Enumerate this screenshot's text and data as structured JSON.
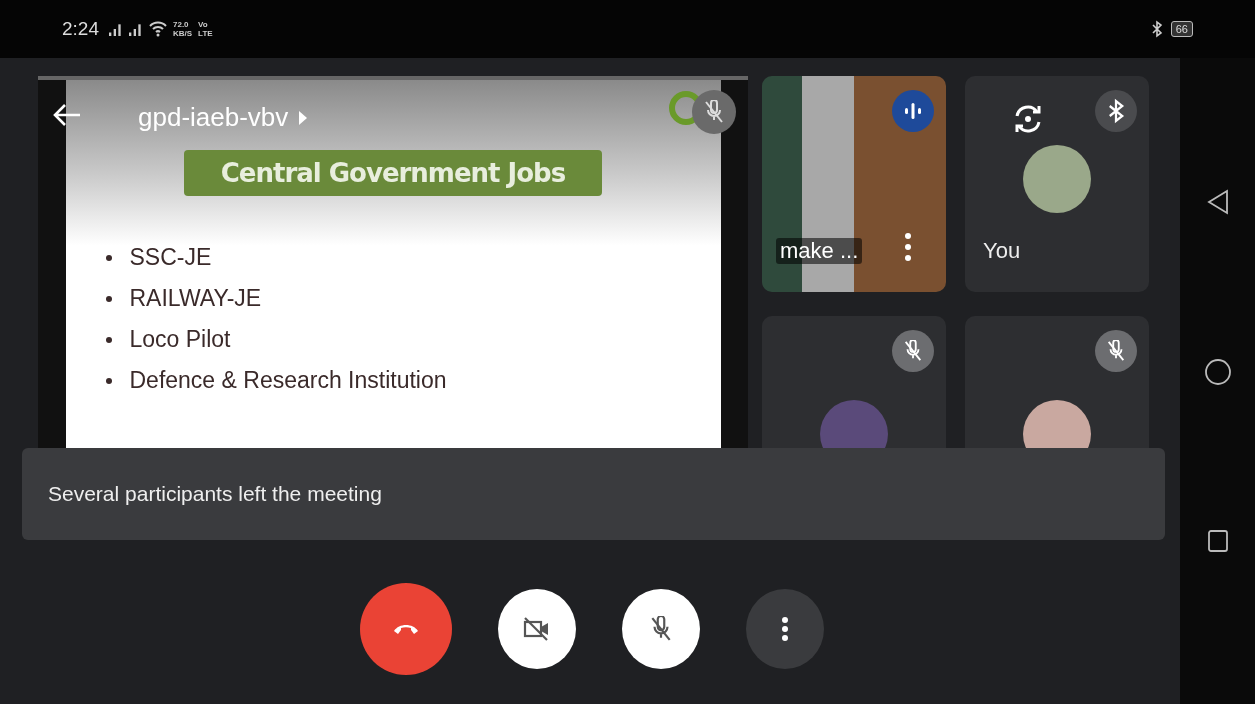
{
  "status_bar": {
    "time": "2:24",
    "speed_value": "72.0",
    "speed_unit": "KB/S",
    "volte_top": "Vo",
    "volte_bottom": "LTE",
    "battery": "66"
  },
  "meeting": {
    "title": "gpd-iaeb-vbv"
  },
  "slide": {
    "heading": "Central Government Jobs",
    "presenter_muted": true,
    "bullets": [
      "SSC-JE",
      "RAILWAY-JE",
      "Loco Pilot",
      "Defence & Research Institution"
    ]
  },
  "tiles": [
    {
      "kind": "video",
      "name": "make ...",
      "speaking": true,
      "muted": false
    },
    {
      "kind": "self",
      "name": "You",
      "speaking": false,
      "muted": false
    },
    {
      "kind": "avatar",
      "speaking": false,
      "muted": true,
      "color": "#5a4a7a"
    },
    {
      "kind": "avatar",
      "speaking": false,
      "muted": true,
      "color": "#c9a8a0"
    }
  ],
  "toast": "Several participants left the meeting",
  "controls": [
    {
      "kind": "end_call"
    },
    {
      "kind": "camera",
      "on": false
    },
    {
      "kind": "mic",
      "on": false
    },
    {
      "kind": "more"
    }
  ]
}
